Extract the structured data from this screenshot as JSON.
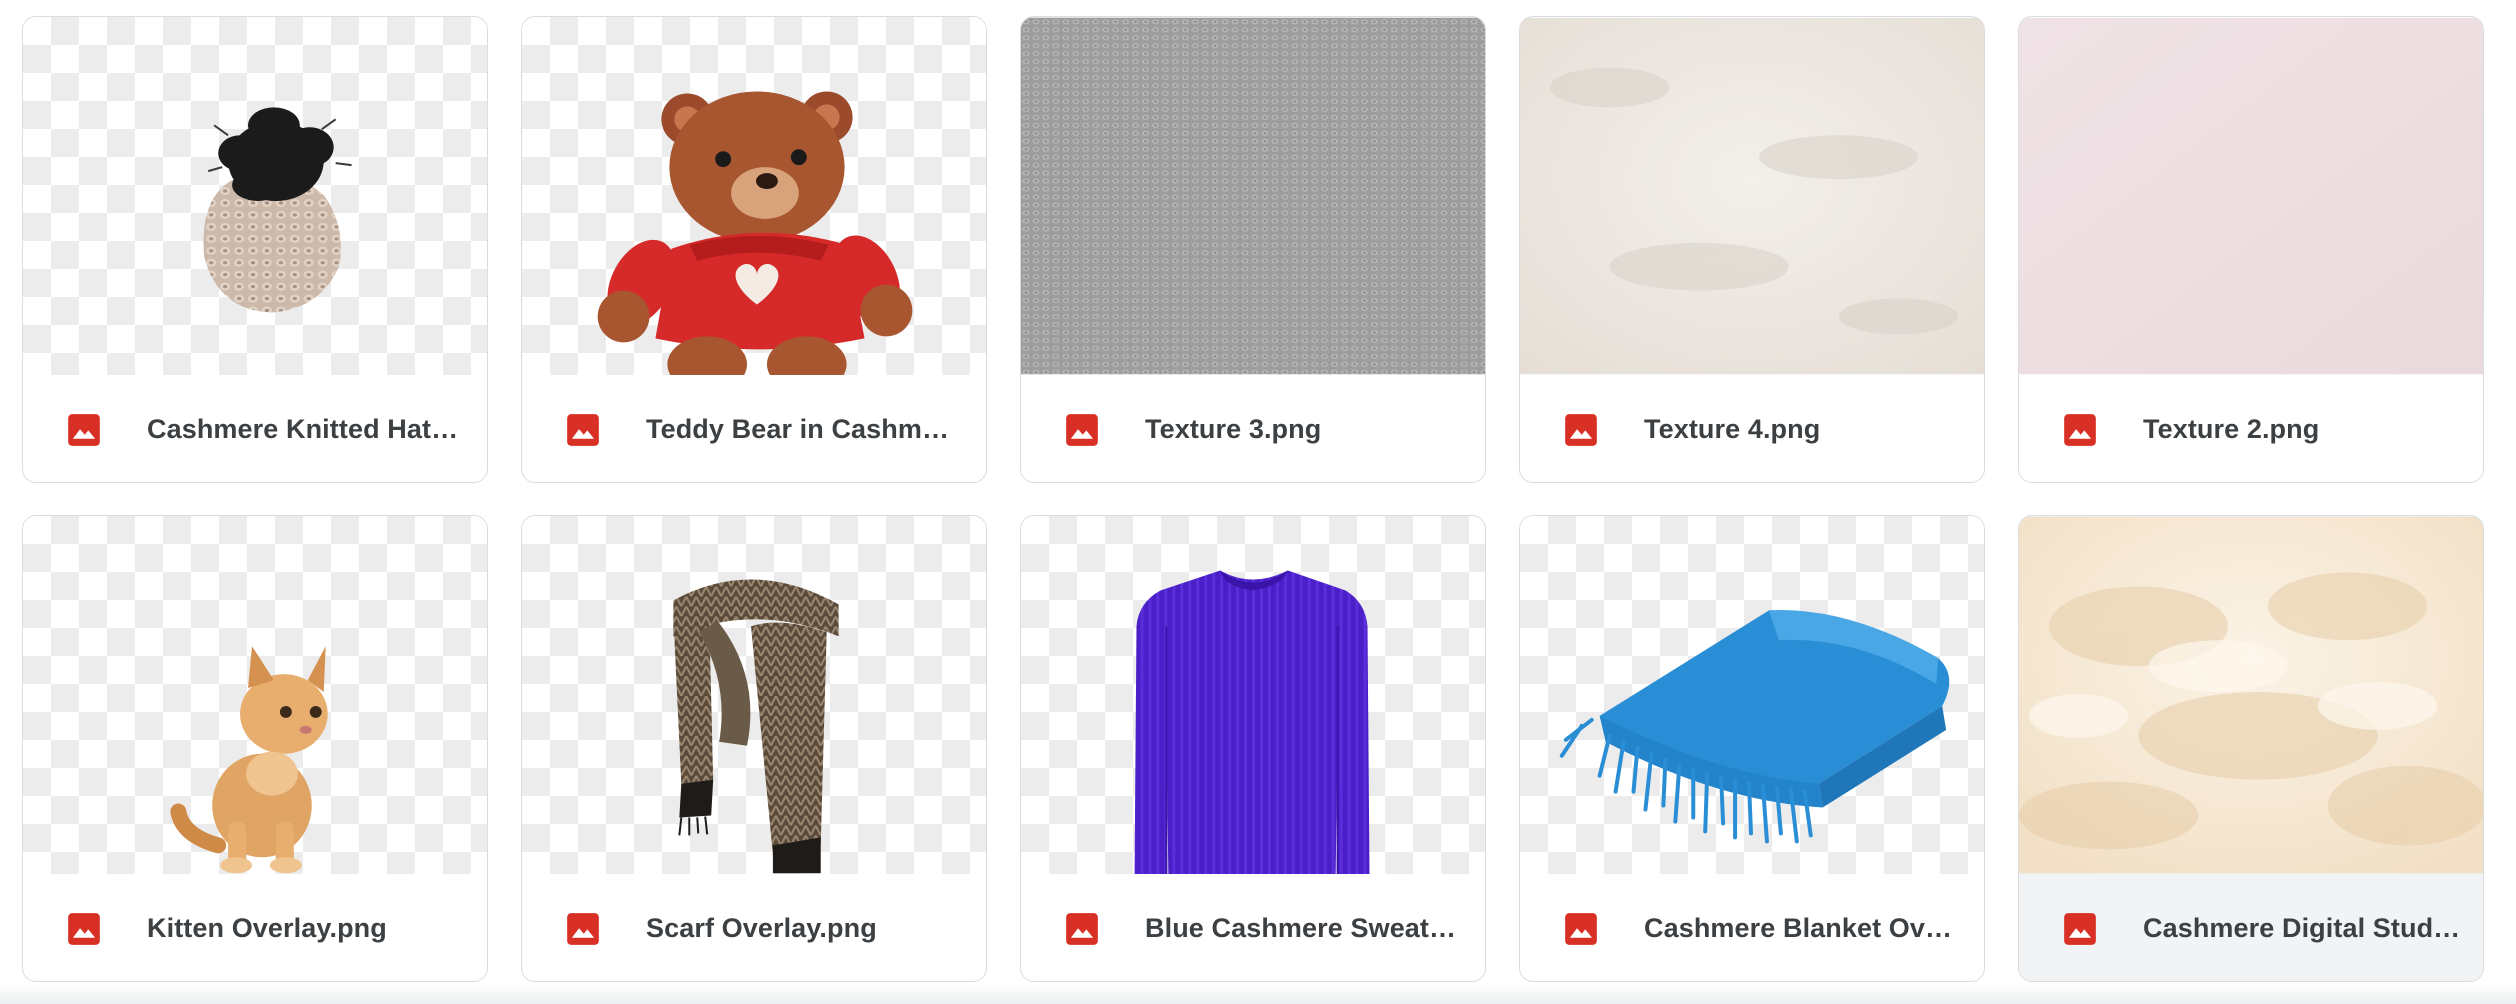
{
  "files": [
    {
      "name": "Cashmere Knitted Hat Overlay.png",
      "icon": "image-file-icon",
      "thumbnail": "knitted-hat-pompom",
      "transparent": true
    },
    {
      "name": "Teddy Bear in Cashmere Sweater.png",
      "icon": "image-file-icon",
      "thumbnail": "teddy-bear-red-sweater",
      "transparent": true
    },
    {
      "name": "Texture 3.png",
      "icon": "image-file-icon",
      "thumbnail": "grey-knit-texture",
      "transparent": false
    },
    {
      "name": "Texture 4.png",
      "icon": "image-file-icon",
      "thumbnail": "cream-wool-texture",
      "transparent": false
    },
    {
      "name": "Texture 2.png",
      "icon": "image-file-icon",
      "thumbnail": "pink-felt-texture",
      "transparent": false
    },
    {
      "name": "Kitten Overlay.png",
      "icon": "image-file-icon",
      "thumbnail": "ginger-kitten",
      "transparent": true
    },
    {
      "name": "Scarf Overlay.png",
      "icon": "image-file-icon",
      "thumbnail": "herringbone-scarf",
      "transparent": true
    },
    {
      "name": "Blue Cashmere Sweater Overlay.png",
      "icon": "image-file-icon",
      "thumbnail": "purple-sweater",
      "transparent": true
    },
    {
      "name": "Cashmere Blanket Overlay.png",
      "icon": "image-file-icon",
      "thumbnail": "blue-fringed-blanket",
      "transparent": true
    },
    {
      "name": "Cashmere Digital Studio Background.png",
      "icon": "image-file-icon",
      "thumbnail": "cashmere-fiber-cloud",
      "transparent": false
    }
  ],
  "colors": {
    "file_icon": "#d93025",
    "card_border": "#dadce0",
    "text": "#3c4043",
    "hovered_card_bg": "#f1f3f4"
  }
}
